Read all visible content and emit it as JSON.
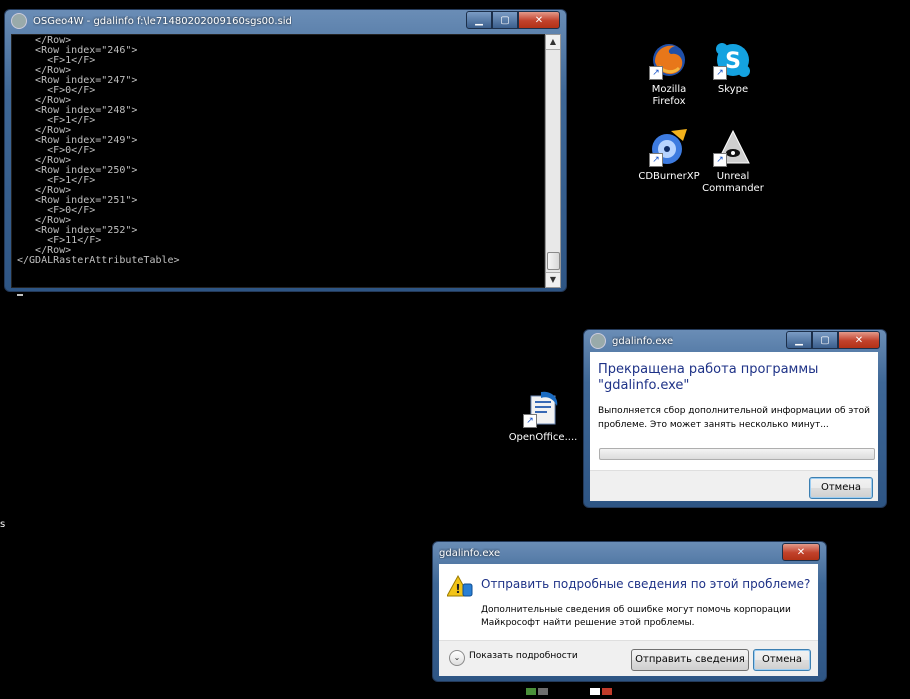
{
  "console": {
    "title": "OSGeo4W - gdalinfo  f:\\le71480202009160sgs00.sid",
    "lines": [
      "   </Row>",
      "   <Row index=\"246\">",
      "     <F>1</F>",
      "   </Row>",
      "   <Row index=\"247\">",
      "     <F>0</F>",
      "   </Row>",
      "   <Row index=\"248\">",
      "     <F>1</F>",
      "   </Row>",
      "   <Row index=\"249\">",
      "     <F>0</F>",
      "   </Row>",
      "   <Row index=\"250\">",
      "     <F>1</F>",
      "   </Row>",
      "   <Row index=\"251\">",
      "     <F>0</F>",
      "   </Row>",
      "   <Row index=\"252\">",
      "     <F>11</F>",
      "   </Row>",
      "</GDALRasterAttributeTable>",
      "",
      ""
    ]
  },
  "desktop": {
    "icons": [
      {
        "label": "Mozilla\nFirefox",
        "icon": "firefox-icon"
      },
      {
        "label": "Skype",
        "icon": "skype-icon"
      },
      {
        "label": "CDBurnerXP",
        "icon": "cdburnerxp-icon"
      },
      {
        "label": "Unreal\nCommander",
        "icon": "unreal-commander-icon"
      },
      {
        "label": "OpenOffice....",
        "icon": "openoffice-icon"
      }
    ],
    "stray_text": "s"
  },
  "dialog1": {
    "title": "gdalinfo.exe",
    "heading": "Прекращена работа программы \"gdalinfo.exe\"",
    "info": "Выполняется сбор дополнительной информации об этой проблеме.  Это может занять несколько минут...",
    "cancel_label": "Отмена"
  },
  "dialog2": {
    "title": "gdalinfo.exe",
    "heading": "Отправить подробные сведения по этой проблеме?",
    "info": "Дополнительные сведения об ошибке могут помочь корпорации Майкрософт найти решение этой проблемы.",
    "details_label": "Показать подробности",
    "send_label": "Отправить сведения",
    "cancel_label": "Отмена"
  },
  "colors": {
    "desktop": "#000000",
    "console_text": "#c0c0c0",
    "heading_blue": "#1e3287",
    "close_red": "#c1412b"
  }
}
